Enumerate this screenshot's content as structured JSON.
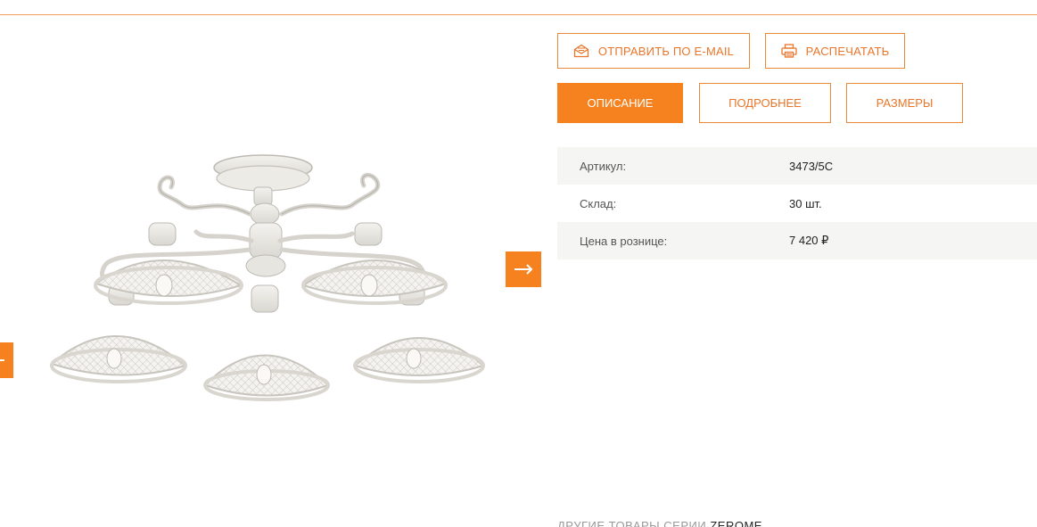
{
  "actions": {
    "email_label": "ОТПРАВИТЬ ПО E-MAIL",
    "email_icon": "envelope-icon",
    "print_label": "РАСПЕЧАТАТЬ",
    "print_icon": "printer-icon"
  },
  "tabs": [
    {
      "label": "ОПИСАНИЕ",
      "active": true
    },
    {
      "label": "ПОДРОБНЕЕ",
      "active": false
    },
    {
      "label": "РАЗМЕРЫ",
      "active": false
    }
  ],
  "specs": [
    {
      "label": "Артикул:",
      "value": "3473/5C"
    },
    {
      "label": "Склад:",
      "value": "30 шт."
    },
    {
      "label": "Цена в рознице:",
      "value": "7 420 ₽"
    }
  ],
  "gallery": {
    "next_icon": "arrow-right-icon",
    "prev_icon": "arrow-left-icon"
  },
  "series": {
    "prefix": "ДРУГИЕ ТОВАРЫ СЕРИИ",
    "name": "ZEROME"
  },
  "colors": {
    "accent": "#f5821f",
    "border": "#e8893a",
    "row_shade": "#f5f5f4"
  }
}
